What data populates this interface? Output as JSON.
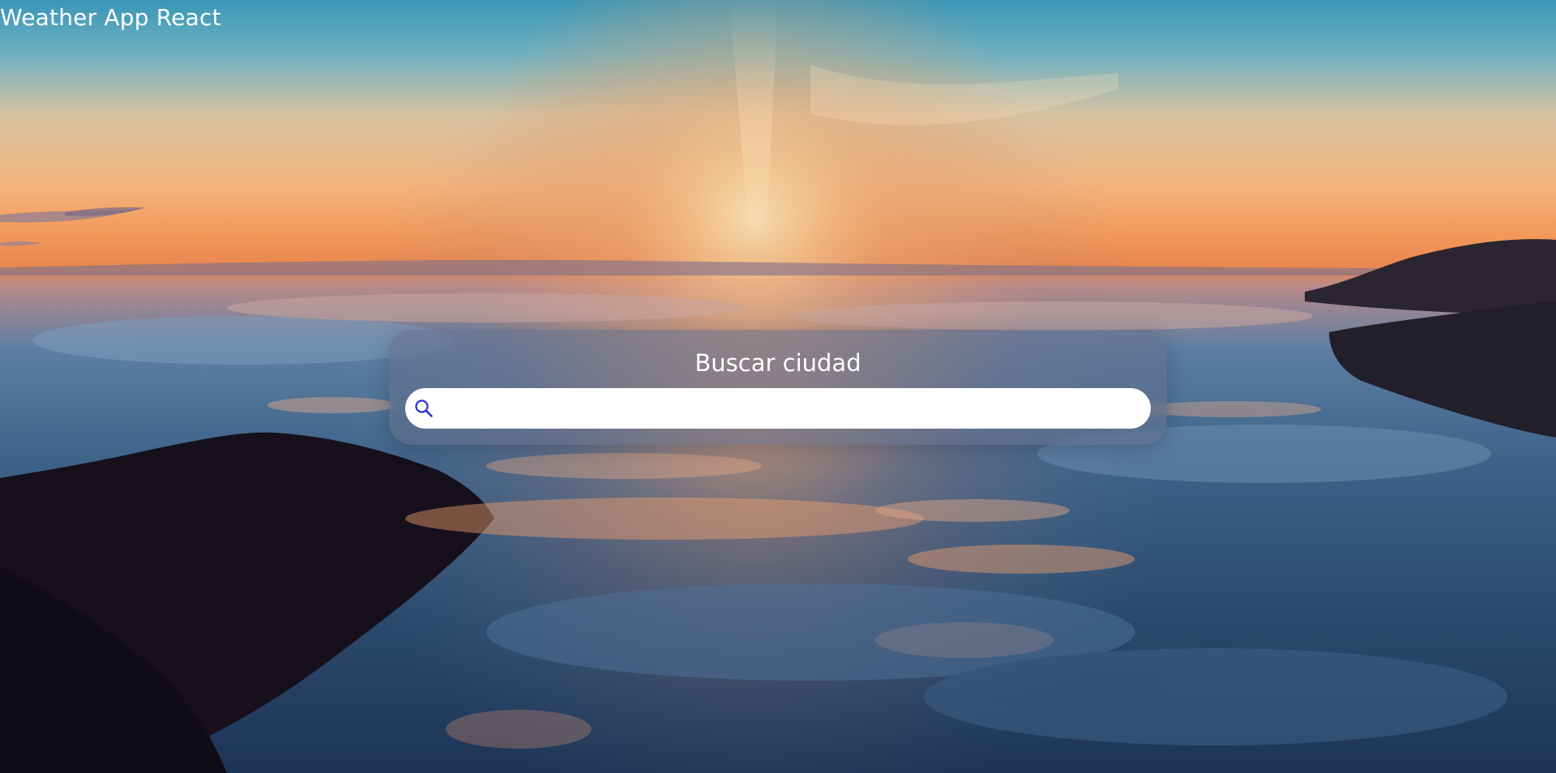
{
  "app": {
    "title": "Weather App React"
  },
  "search": {
    "heading": "Buscar ciudad",
    "value": "",
    "placeholder": "",
    "icon": "search-icon"
  },
  "colors": {
    "icon_accent": "#2a2fd0",
    "card_bg": "rgba(98,112,140,0.55)",
    "text": "#ffffff"
  }
}
